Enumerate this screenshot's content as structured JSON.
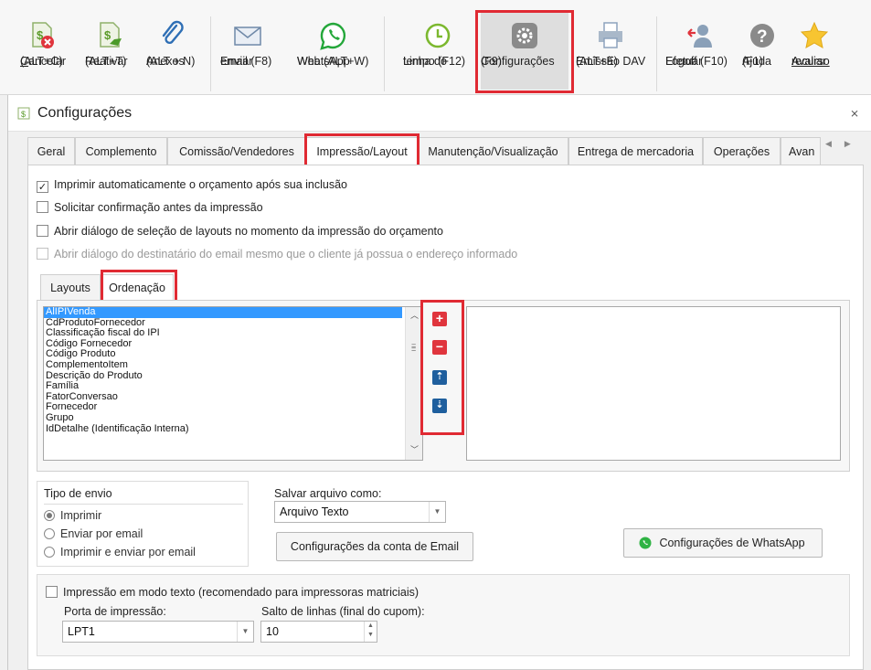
{
  "toolbar": {
    "cancelar": {
      "label1": "Cancelar",
      "label1_u": "C",
      "label1_rest": "ancelar",
      "label2": "(ALT+C)"
    },
    "reativar": {
      "label1": "Reativar",
      "label2": "(ALT+T)"
    },
    "anexos": {
      "label1": "Anexos",
      "label2": "(ALT + N)"
    },
    "enviar_email": {
      "label1": "Enviar",
      "label2": "email (F8)"
    },
    "whatsapp": {
      "label1": "WhatsApp",
      "label2": "Web (ALT+W)"
    },
    "linha_tempo": {
      "label1": "Linha do",
      "label2": "tempo (F12)"
    },
    "configuracoes": {
      "label1": "Configurações",
      "label2": "(F9)"
    },
    "emissao_dav": {
      "label1": "Emissão DAV",
      "label2": "(ALT+E)"
    },
    "efetuar_logoff": {
      "label1": "Efetuar",
      "label2": "Logoff (F10)"
    },
    "ajuda": {
      "label1": "Ajuda",
      "label2": "(F1)"
    },
    "avaliar": {
      "label1": "Avaliar",
      "label2": "recurso"
    }
  },
  "dialog": {
    "title": "Configurações",
    "close": "⨯"
  },
  "tabs": [
    "Geral",
    "Complemento",
    "Comissão/Vendedores",
    "Impressão/Layout",
    "Manutenção/Visualização",
    "Entrega de mercadoria",
    "Operações",
    "Avan"
  ],
  "options": {
    "imprimir_auto": "Imprimir automaticamente o orçamento após sua inclusão",
    "solicitar_conf": "Solicitar confirmação antes da impressão",
    "abrir_dialogo_layouts": "Abrir diálogo de seleção de layouts no momento da impressão do orçamento",
    "abrir_dialogo_email": "Abrir diálogo do destinatário do email mesmo que o cliente já possua o endereço informado"
  },
  "subtabs": [
    "Layouts",
    "Ordenação"
  ],
  "ordenacao_items": [
    "AlIPIVenda",
    "CdProdutoFornecedor",
    "Classificação fiscal do IPI",
    "Código Fornecedor",
    "Código Produto",
    "ComplementoItem",
    "Descrição do Produto",
    "Família",
    "FatorConversao",
    "Fornecedor",
    "Grupo",
    "IdDetalhe (Identificação Interna)"
  ],
  "envio": {
    "title": "Tipo de envio",
    "imprimir": "Imprimir",
    "enviar_email": "Enviar por email",
    "imprimir_enviar": "Imprimir e enviar por email"
  },
  "salvar": {
    "label": "Salvar arquivo como:",
    "value": "Arquivo Texto"
  },
  "buttons": {
    "conta_email": "Configurações da conta de Email",
    "whatsapp": "Configurações de WhatsApp"
  },
  "modo_texto": {
    "label": "Impressão em modo texto (recomendado para impressoras matriciais)",
    "porta_label": "Porta de impressão:",
    "porta_value": "LPT1",
    "salto_label": "Salto de linhas (final do cupom):",
    "salto_value": "10"
  },
  "colors": {
    "highlight": "#e02a33",
    "selection": "#3399ff",
    "whatsapp_green": "#2fb344"
  }
}
